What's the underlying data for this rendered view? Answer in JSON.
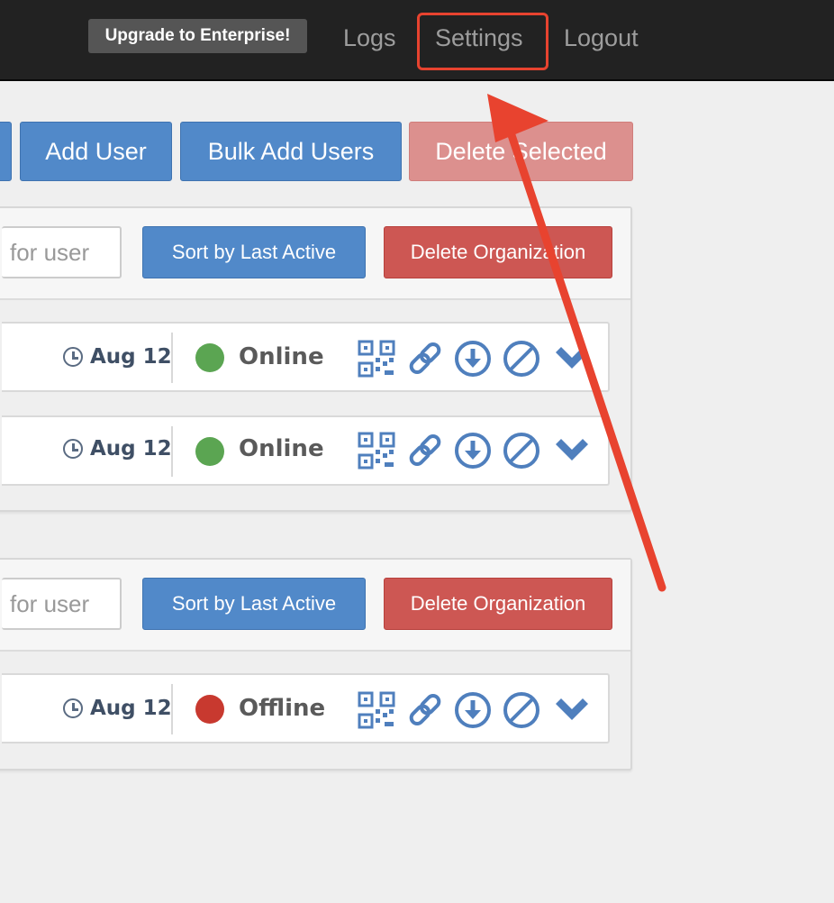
{
  "navbar": {
    "upgrade_label": "Upgrade to Enterprise!",
    "links": {
      "logs": "Logs",
      "settings": "Settings",
      "logout": "Logout"
    }
  },
  "toolbar": {
    "add_user": "Add User",
    "bulk_add_users": "Bulk Add Users",
    "delete_selected": "Delete Selected"
  },
  "organizations": [
    {
      "search_placeholder": "for user",
      "sort_label": "Sort by Last Active",
      "delete_org_label": "Delete Organization",
      "users": [
        {
          "last_active": "Aug 12",
          "status": "Online"
        },
        {
          "last_active": "Aug 12",
          "status": "Online"
        }
      ]
    },
    {
      "search_placeholder": "for user",
      "sort_label": "Sort by Last Active",
      "delete_org_label": "Delete Organization",
      "users": [
        {
          "last_active": "Aug 12",
          "status": "Offline"
        }
      ]
    }
  ],
  "icons": [
    "clock-icon",
    "qr-code-icon",
    "link-icon",
    "download-icon",
    "disable-icon",
    "chevron-down-icon"
  ],
  "colors": {
    "navbar": "#222222",
    "primary": "#5189c9",
    "danger": "#cd5753",
    "online": "#5ba552",
    "offline": "#c8392f",
    "annotation": "#e8432f"
  }
}
